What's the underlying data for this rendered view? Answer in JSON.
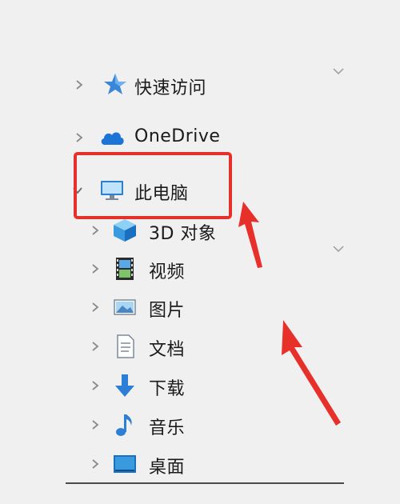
{
  "nav": {
    "quick_access": {
      "label": "快速访问",
      "icon": "star-pin-icon"
    },
    "onedrive": {
      "label": "OneDrive",
      "icon": "cloud-icon"
    },
    "this_pc": {
      "label": "此电脑",
      "icon": "monitor-icon",
      "expanded": true
    },
    "children": [
      {
        "label": "3D 对象",
        "icon": "cube-3d-icon"
      },
      {
        "label": "视频",
        "icon": "film-icon"
      },
      {
        "label": "图片",
        "icon": "picture-icon"
      },
      {
        "label": "文档",
        "icon": "document-icon"
      },
      {
        "label": "下载",
        "icon": "download-arrow-icon"
      },
      {
        "label": "音乐",
        "icon": "music-note-icon"
      },
      {
        "label": "桌面",
        "icon": "desktop-icon"
      }
    ]
  },
  "colors": {
    "annotation_red": "#e8302b",
    "background": "#f0f0f0",
    "chevron": "#8a8a8a"
  }
}
